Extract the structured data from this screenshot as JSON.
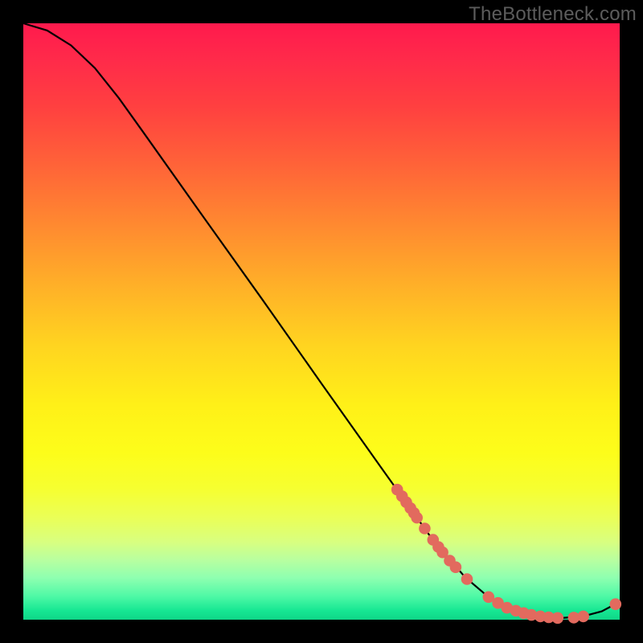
{
  "watermark": "TheBottleneck.com",
  "colors": {
    "curve_stroke": "#000000",
    "dot_fill": "#e26a5e",
    "dot_stroke": "#b94f45"
  },
  "chart_data": {
    "type": "line",
    "title": "",
    "xlabel": "",
    "ylabel": "",
    "xlim": [
      0,
      100
    ],
    "ylim": [
      0,
      100
    ],
    "curve": [
      {
        "x": 0.0,
        "y": 100.0
      },
      {
        "x": 4.0,
        "y": 98.8
      },
      {
        "x": 8.0,
        "y": 96.3
      },
      {
        "x": 12.0,
        "y": 92.5
      },
      {
        "x": 16.0,
        "y": 87.5
      },
      {
        "x": 20.0,
        "y": 81.9
      },
      {
        "x": 30.0,
        "y": 67.8
      },
      {
        "x": 40.0,
        "y": 53.8
      },
      {
        "x": 50.0,
        "y": 39.6
      },
      {
        "x": 60.0,
        "y": 25.5
      },
      {
        "x": 68.0,
        "y": 14.3
      },
      {
        "x": 74.0,
        "y": 7.2
      },
      {
        "x": 78.0,
        "y": 3.8
      },
      {
        "x": 82.0,
        "y": 1.7
      },
      {
        "x": 86.0,
        "y": 0.6
      },
      {
        "x": 90.0,
        "y": 0.25
      },
      {
        "x": 94.0,
        "y": 0.6
      },
      {
        "x": 97.0,
        "y": 1.4
      },
      {
        "x": 100.0,
        "y": 3.0
      }
    ],
    "dots": [
      {
        "x": 62.7,
        "y": 21.8
      },
      {
        "x": 63.5,
        "y": 20.7
      },
      {
        "x": 64.2,
        "y": 19.7
      },
      {
        "x": 64.9,
        "y": 18.7
      },
      {
        "x": 65.5,
        "y": 17.9
      },
      {
        "x": 66.0,
        "y": 17.1
      },
      {
        "x": 67.3,
        "y": 15.3
      },
      {
        "x": 68.7,
        "y": 13.4
      },
      {
        "x": 69.6,
        "y": 12.2
      },
      {
        "x": 70.3,
        "y": 11.3
      },
      {
        "x": 71.5,
        "y": 9.9
      },
      {
        "x": 72.5,
        "y": 8.8
      },
      {
        "x": 74.4,
        "y": 6.8
      },
      {
        "x": 78.0,
        "y": 3.8
      },
      {
        "x": 79.6,
        "y": 2.8
      },
      {
        "x": 81.1,
        "y": 2.0
      },
      {
        "x": 82.6,
        "y": 1.5
      },
      {
        "x": 83.9,
        "y": 1.1
      },
      {
        "x": 85.2,
        "y": 0.8
      },
      {
        "x": 86.7,
        "y": 0.55
      },
      {
        "x": 88.1,
        "y": 0.4
      },
      {
        "x": 89.6,
        "y": 0.3
      },
      {
        "x": 92.3,
        "y": 0.35
      },
      {
        "x": 93.9,
        "y": 0.55
      },
      {
        "x": 99.3,
        "y": 2.6
      }
    ]
  }
}
